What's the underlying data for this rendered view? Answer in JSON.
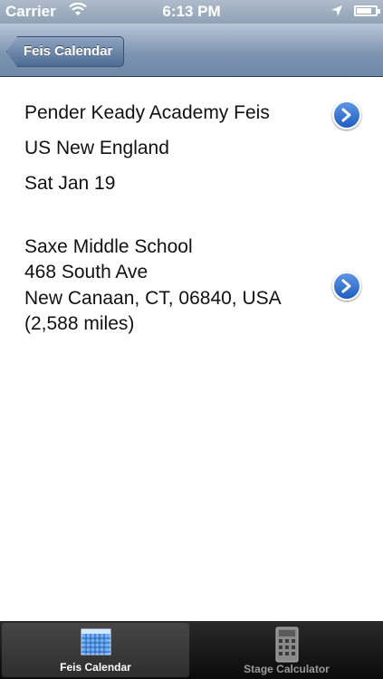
{
  "status_bar": {
    "carrier": "Carrier",
    "time": "6:13 PM"
  },
  "nav": {
    "back_label": "Feis Calendar"
  },
  "event": {
    "name": "Pender Keady Academy Feis",
    "region": "US New England",
    "date": "Sat Jan 19"
  },
  "venue": {
    "name": "Saxe Middle School",
    "street": "468 South Ave",
    "city_line": "New Canaan, CT, 06840, USA",
    "distance": "(2,588 miles)"
  },
  "tabs": [
    {
      "label": "Feis Calendar",
      "icon": "calendar-icon",
      "selected": true
    },
    {
      "label": "Stage Calculator",
      "icon": "calculator-icon",
      "selected": false
    }
  ],
  "colors": {
    "nav": "#7b93b0",
    "disclosure": "#2a6ad0",
    "tab_bar": "#111111"
  }
}
